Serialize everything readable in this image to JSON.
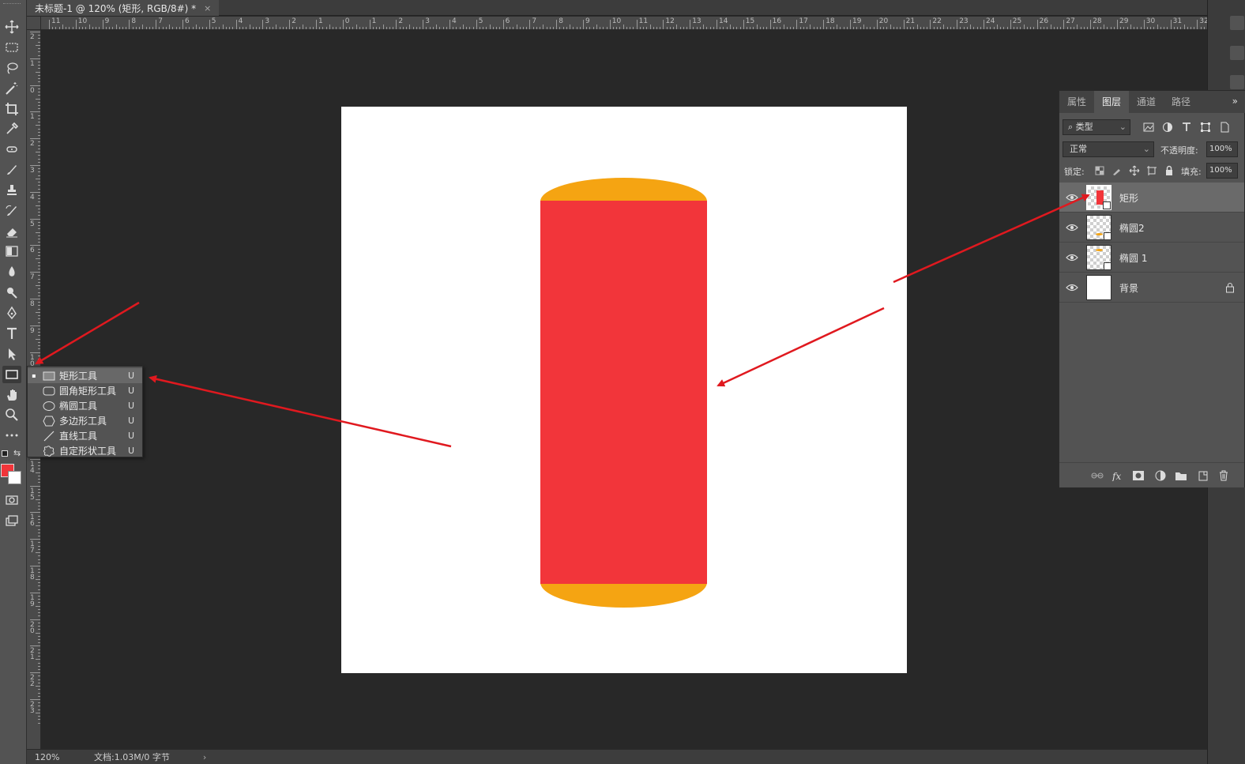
{
  "document": {
    "tab_title": "未标题-1 @ 120% (矩形, RGB/8#) *",
    "close_glyph": "×"
  },
  "ruler": {
    "h_labels": [
      "11",
      "10",
      "9",
      "8",
      "7",
      "6",
      "5",
      "4",
      "3",
      "2",
      "1",
      "0",
      "1",
      "2",
      "3",
      "4",
      "5",
      "6",
      "7",
      "8",
      "9",
      "10",
      "11",
      "12",
      "13",
      "14",
      "15",
      "16",
      "17",
      "18",
      "19",
      "20",
      "21",
      "22",
      "23",
      "24",
      "25",
      "26",
      "27",
      "28",
      "29",
      "30",
      "31",
      "32"
    ],
    "v_labels": [
      "2",
      "1",
      "0",
      "1",
      "2",
      "3",
      "4",
      "5",
      "6",
      "7",
      "8",
      "9",
      "1\n0",
      "1\n1",
      "1\n2",
      "1\n3",
      "1\n4",
      "1\n5",
      "1\n6",
      "1\n7",
      "1\n8",
      "1\n9",
      "2\n0",
      "2\n1",
      "2\n2",
      "2\n3"
    ]
  },
  "toolbar": {
    "tools": [
      {
        "name": "move-tool",
        "icon": "move-icon"
      },
      {
        "name": "marquee-tool",
        "icon": "marquee-icon"
      },
      {
        "name": "lasso-tool",
        "icon": "lasso-icon"
      },
      {
        "name": "magic-wand-tool",
        "icon": "magic-wand-icon"
      },
      {
        "name": "crop-tool",
        "icon": "crop-icon"
      },
      {
        "name": "eyedropper-tool",
        "icon": "eyedropper-icon"
      },
      {
        "name": "healing-tool",
        "icon": "healing-icon"
      },
      {
        "name": "brush-tool",
        "icon": "brush-icon"
      },
      {
        "name": "stamp-tool",
        "icon": "stamp-icon"
      },
      {
        "name": "history-brush-tool",
        "icon": "history-brush-icon"
      },
      {
        "name": "eraser-tool",
        "icon": "eraser-icon"
      },
      {
        "name": "gradient-tool",
        "icon": "gradient-icon"
      },
      {
        "name": "blur-tool",
        "icon": "blur-icon"
      },
      {
        "name": "dodge-tool",
        "icon": "dodge-icon"
      },
      {
        "name": "pen-tool",
        "icon": "pen-icon"
      },
      {
        "name": "type-tool",
        "icon": "type-icon"
      },
      {
        "name": "path-selection-tool",
        "icon": "path-selection-icon"
      },
      {
        "name": "rectangle-tool",
        "icon": "rectangle-icon"
      },
      {
        "name": "hand-tool",
        "icon": "hand-icon"
      },
      {
        "name": "zoom-tool",
        "icon": "zoom-icon"
      },
      {
        "name": "more-tools",
        "icon": "more-icon"
      }
    ],
    "foreground_color": "#f2353a",
    "background_color": "#ffffff"
  },
  "flyout": {
    "items": [
      {
        "label": "矩形工具",
        "key": "U",
        "icon": "rectangle-icon",
        "active": true
      },
      {
        "label": "圆角矩形工具",
        "key": "U",
        "icon": "rounded-rectangle-icon",
        "active": false
      },
      {
        "label": "椭圆工具",
        "key": "U",
        "icon": "ellipse-icon",
        "active": false
      },
      {
        "label": "多边形工具",
        "key": "U",
        "icon": "polygon-icon",
        "active": false
      },
      {
        "label": "直线工具",
        "key": "U",
        "icon": "line-icon",
        "active": false
      },
      {
        "label": "自定形状工具",
        "key": "U",
        "icon": "custom-shape-icon",
        "active": false
      }
    ],
    "active_marker": "▪"
  },
  "canvas": {
    "background": "#ffffff",
    "cylinder_body_color": "#f2353a",
    "cylinder_cap_color": "#f5a412"
  },
  "status": {
    "zoom": "120%",
    "doc_info": "文档:1.03M/0 字节",
    "arrow": "›"
  },
  "layers_panel": {
    "tabs": [
      "属性",
      "图层",
      "通道",
      "路径"
    ],
    "active_tab": "图层",
    "menu_glyph": "»",
    "filter_label": "类型",
    "blend_mode": "正常",
    "opacity_label": "不透明度:",
    "opacity_value": "100%",
    "lock_label": "锁定:",
    "fill_label": "填充:",
    "fill_value": "100%",
    "layers": [
      {
        "name": "矩形",
        "selected": true,
        "thumb": "rect"
      },
      {
        "name": "椭圆2",
        "selected": false,
        "thumb": "ellipse2"
      },
      {
        "name": "椭圆 1",
        "selected": false,
        "thumb": "ellipse1"
      },
      {
        "name": "背景",
        "selected": false,
        "thumb": "white",
        "locked": true
      }
    ]
  },
  "annotation_color": "#e0191f"
}
